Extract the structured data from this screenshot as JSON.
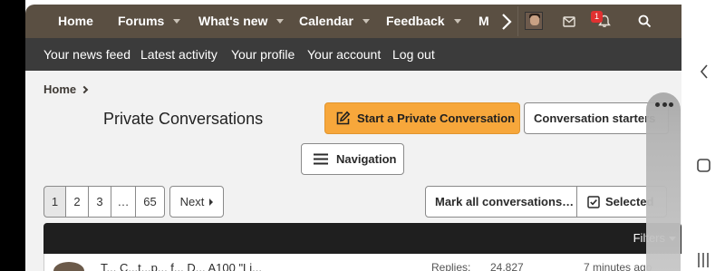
{
  "nav": {
    "items": [
      {
        "label": "Home",
        "dropdown": false
      },
      {
        "label": "Forums",
        "dropdown": true
      },
      {
        "label": "What's new",
        "dropdown": true
      },
      {
        "label": "Calendar",
        "dropdown": true
      },
      {
        "label": "Feedback",
        "dropdown": true
      },
      {
        "label": "M",
        "dropdown": false
      }
    ],
    "notification_count": "1"
  },
  "subnav": {
    "items": [
      "Your news feed",
      "Latest activity",
      "Your profile",
      "Your account",
      "Log out"
    ]
  },
  "breadcrumb": {
    "home": "Home"
  },
  "page": {
    "title": "Private Conversations",
    "start_button": "Start a Private Conversation",
    "starters_button": "Conversation starters",
    "navigation_button": "Navigation"
  },
  "pagination": {
    "pages": [
      "1",
      "2",
      "3",
      "…",
      "65"
    ],
    "current": "1",
    "next": "Next"
  },
  "actions": {
    "mark_all": "Mark all conversations…",
    "selected": "Selected"
  },
  "table": {
    "filters": "Filters",
    "row": {
      "title": "T... C...t...p... f... D... A100 \"Li...",
      "replies_label": "Replies:",
      "replies_value": "24,827",
      "time": "7 minutes ago"
    }
  },
  "colors": {
    "nav_bg": "#5a4f42",
    "subnav_bg": "#3b3b3b",
    "accent": "#f7a73b",
    "table_header": "#1f1f1f"
  }
}
